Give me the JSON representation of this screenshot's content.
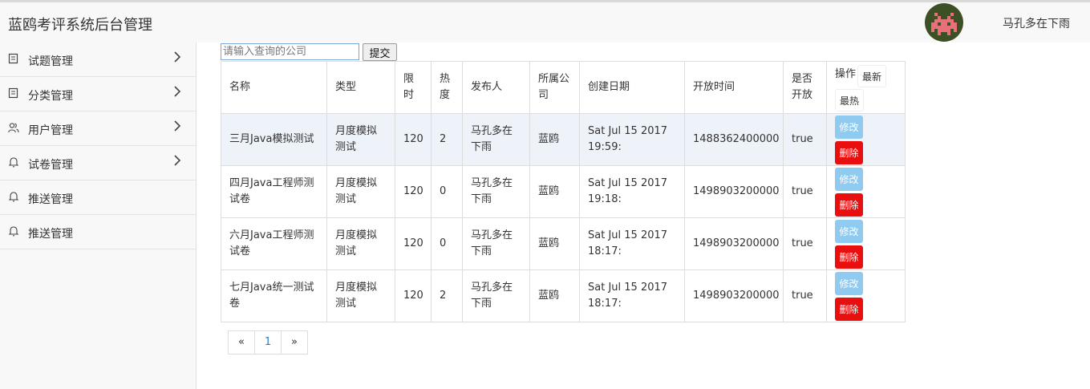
{
  "header": {
    "title": "蓝鸥考评系统后台管理",
    "username": "马孔多在下雨",
    "avatar_icon": "pixel-invader-avatar",
    "avatar_bg": "#3c4f25",
    "avatar_fg": "#e8707a"
  },
  "sidebar": {
    "items": [
      {
        "label": "试题管理",
        "icon": "document-icon",
        "has_submenu": true
      },
      {
        "label": "分类管理",
        "icon": "document-icon",
        "has_submenu": true
      },
      {
        "label": "用户管理",
        "icon": "users-icon",
        "has_submenu": true
      },
      {
        "label": "试卷管理",
        "icon": "bell-icon",
        "has_submenu": true
      },
      {
        "label": "推送管理",
        "icon": "bell-icon",
        "has_submenu": false
      },
      {
        "label": "推送管理",
        "icon": "bell-icon",
        "has_submenu": false
      }
    ]
  },
  "search": {
    "placeholder": "请输入查询的公司",
    "value": "",
    "submit_label": "提交"
  },
  "table": {
    "headers": {
      "name": "名称",
      "type": "类型",
      "time_limit": "限时",
      "heat": "热度",
      "publisher": "发布人",
      "company": "所属公司",
      "created": "创建日期",
      "open_time": "开放时间",
      "is_open": "是否开放",
      "ops": "操作",
      "newest": "最新",
      "hottest": "最热"
    },
    "rows": [
      {
        "name": "三月Java模拟测试",
        "type": "月度模拟测试",
        "time_limit": "120",
        "heat": "2",
        "publisher": "马孔多在下雨",
        "company": "蓝鸥",
        "created": "Sat Jul 15 2017 19:59:",
        "open_time": "1488362400000",
        "is_open": "true",
        "edit": "修改",
        "delete": "删除"
      },
      {
        "name": "四月Java工程师测试卷",
        "type": "月度模拟测试",
        "time_limit": "120",
        "heat": "0",
        "publisher": "马孔多在下雨",
        "company": "蓝鸥",
        "created": "Sat Jul 15 2017 19:18:",
        "open_time": "1498903200000",
        "is_open": "true",
        "edit": "修改",
        "delete": "删除"
      },
      {
        "name": "六月Java工程师测试卷",
        "type": "月度模拟测试",
        "time_limit": "120",
        "heat": "0",
        "publisher": "马孔多在下雨",
        "company": "蓝鸥",
        "created": "Sat Jul 15 2017 18:17:",
        "open_time": "1498903200000",
        "is_open": "true",
        "edit": "修改",
        "delete": "删除"
      },
      {
        "name": "七月Java统一测试卷",
        "type": "月度模拟测试",
        "time_limit": "120",
        "heat": "2",
        "publisher": "马孔多在下雨",
        "company": "蓝鸥",
        "created": "Sat Jul 15 2017 18:17:",
        "open_time": "1498903200000",
        "is_open": "true",
        "edit": "修改",
        "delete": "删除"
      }
    ]
  },
  "pagination": {
    "prev": "«",
    "current": "1",
    "next": "»"
  },
  "colors": {
    "edit_button": "#8fcbf0",
    "delete_button": "#ea0f0f",
    "striped_row": "#eef2f9"
  }
}
